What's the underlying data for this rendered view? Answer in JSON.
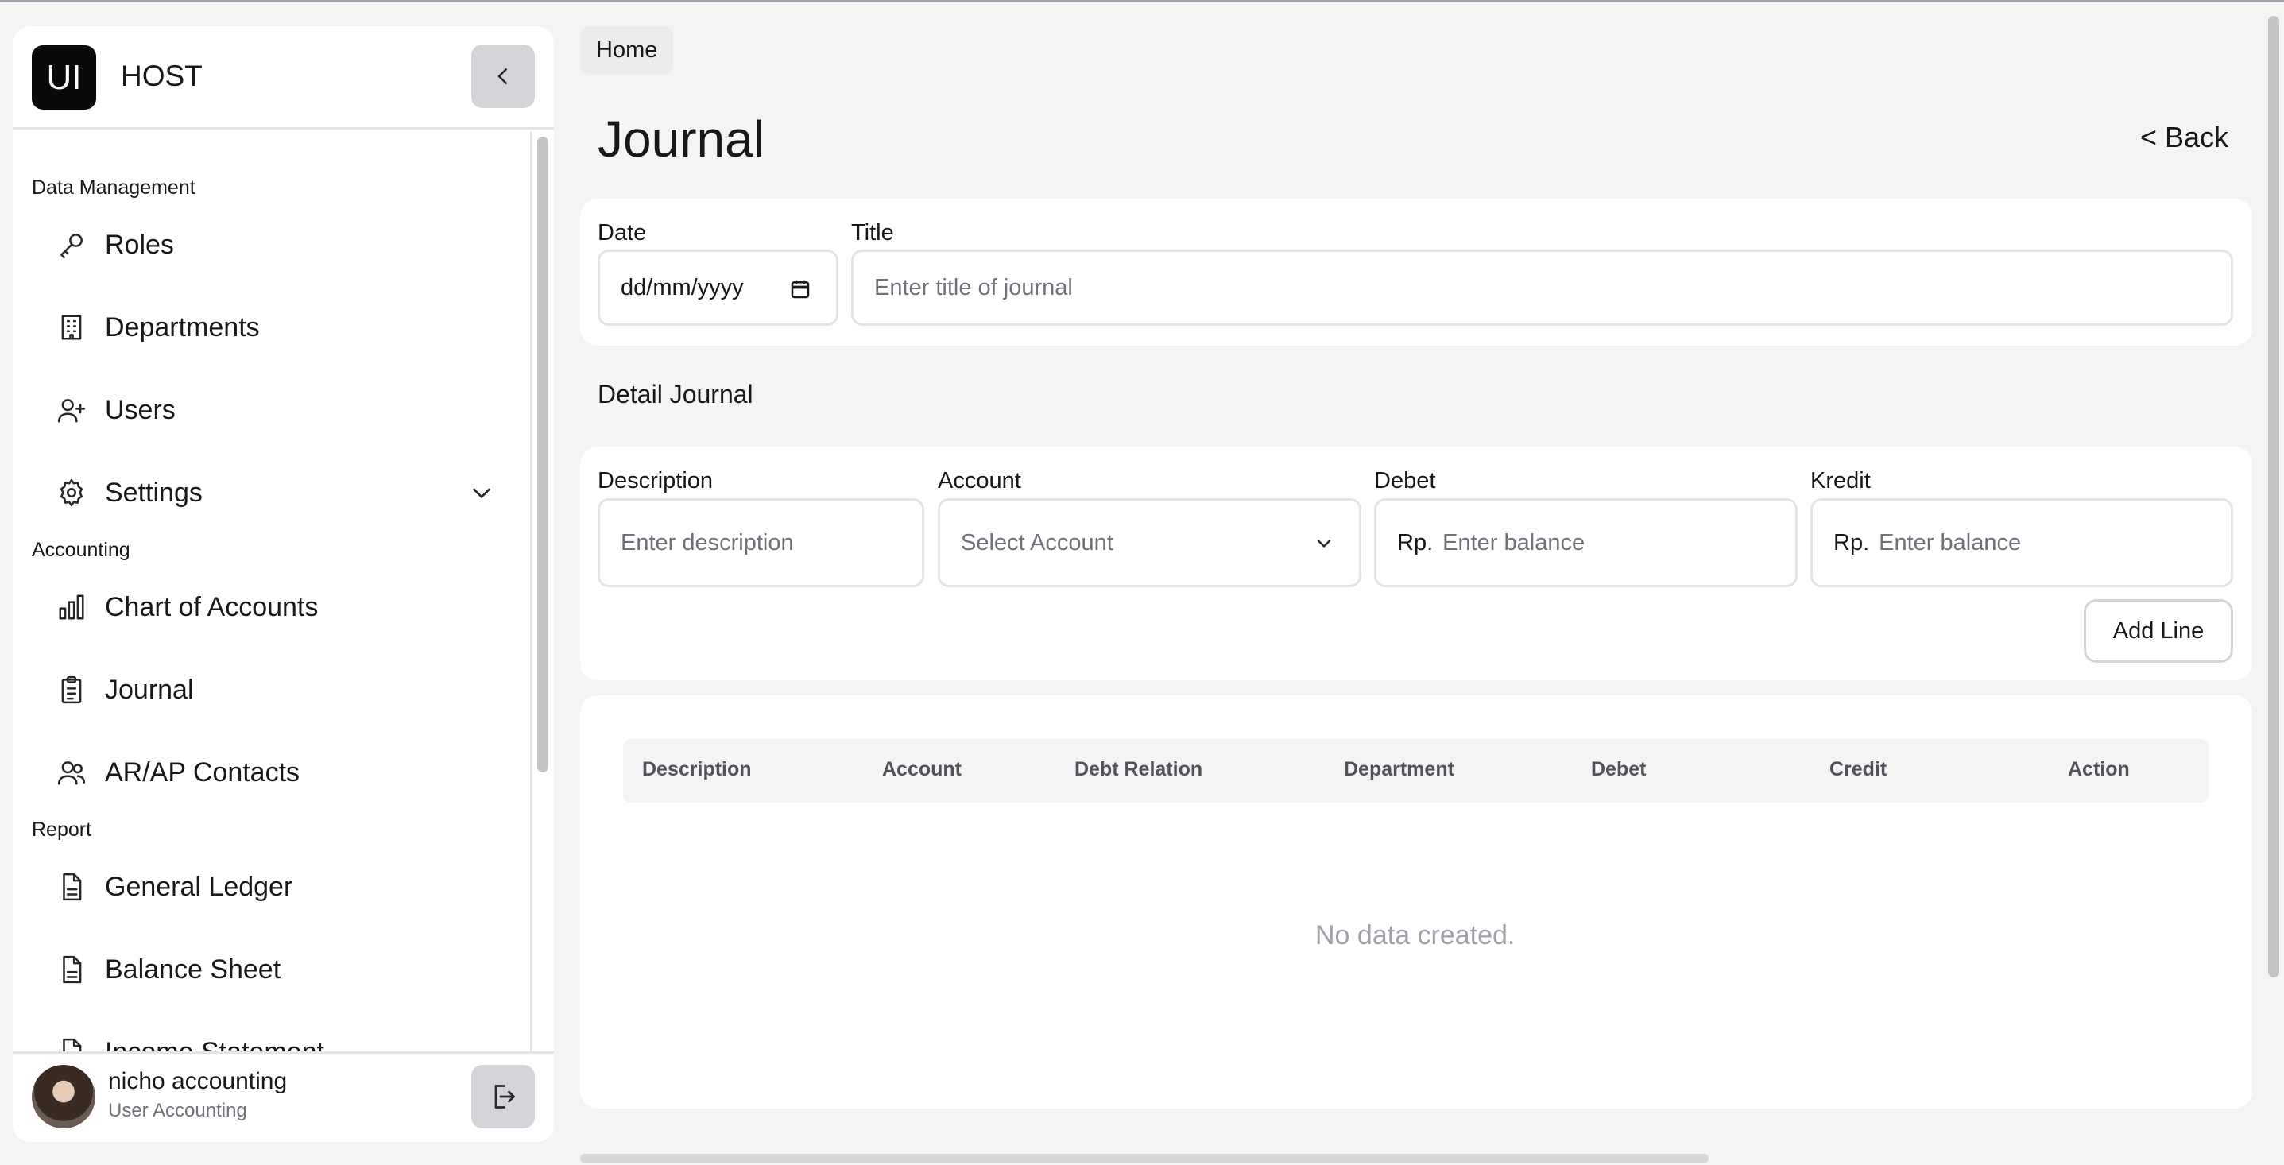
{
  "sidebar": {
    "logo_text": "UI",
    "brand": "HOST",
    "sections": {
      "data_management": "Data Management",
      "accounting": "Accounting",
      "report": "Report"
    },
    "items": {
      "roles": "Roles",
      "departments": "Departments",
      "users": "Users",
      "settings": "Settings",
      "chart_of_accounts": "Chart of Accounts",
      "journal": "Journal",
      "arap_contacts": "AR/AP Contacts",
      "general_ledger": "General Ledger",
      "balance_sheet": "Balance Sheet",
      "income_statement": "Income Statement"
    },
    "user": {
      "name": "nicho accounting",
      "role": "User Accounting"
    }
  },
  "breadcrumb": "Home",
  "page": {
    "title": "Journal",
    "back": "< Back"
  },
  "header_form": {
    "date_label": "Date",
    "date_value": "dd/mm/yyyy",
    "title_label": "Title",
    "title_placeholder": "Enter title of journal"
  },
  "detail": {
    "section_title": "Detail Journal",
    "description_label": "Description",
    "description_placeholder": "Enter description",
    "account_label": "Account",
    "account_placeholder": "Select Account",
    "debet_label": "Debet",
    "kredit_label": "Kredit",
    "currency_prefix": "Rp.",
    "balance_placeholder": "Enter balance",
    "add_line": "Add Line"
  },
  "table": {
    "columns": [
      "Description",
      "Account",
      "Debt Relation",
      "Department",
      "Debet",
      "Credit",
      "Action"
    ],
    "empty_text": "No data created."
  },
  "icons": {
    "collapse": "chevron-left-icon",
    "logout": "logout-icon",
    "roles": "key-icon",
    "departments": "building-icon",
    "users": "user-plus-icon",
    "settings": "gear-icon",
    "chart_of_accounts": "bar-chart-icon",
    "journal": "clipboard-icon",
    "arap_contacts": "users-icon",
    "report": "file-text-icon"
  }
}
